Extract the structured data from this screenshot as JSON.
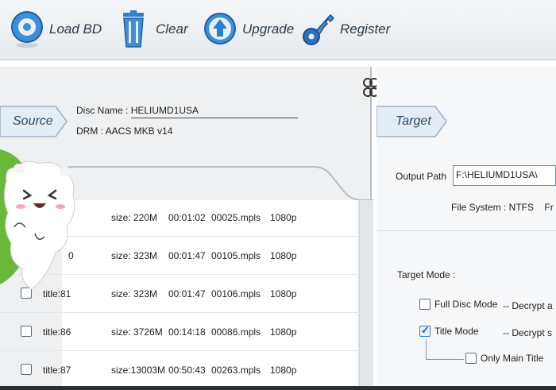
{
  "toolbar": {
    "load_label": "Load BD",
    "clear_label": "Clear",
    "upgrade_label": "Upgrade",
    "register_label": "Register"
  },
  "source": {
    "tab_label": "Source",
    "disc_name_label": "Disc Name :",
    "disc_name_value": "HELIUMD1USA",
    "drm_label": "DRM :",
    "drm_value": "AACS MKB v14"
  },
  "titles": [
    {
      "title": "",
      "size": "size:  220M",
      "duration": "00:01:02",
      "mpls": "00025.mpls",
      "res": "1080p"
    },
    {
      "title": "0",
      "size": "size:  323M",
      "duration": "00:01:47",
      "mpls": "00105.mpls",
      "res": "1080p"
    },
    {
      "title": "title:81",
      "size": "size:  323M",
      "duration": "00:01:47",
      "mpls": "00106.mpls",
      "res": "1080p"
    },
    {
      "title": "title:86",
      "size": "size: 3726M",
      "duration": "00:14:18",
      "mpls": "00086.mpls",
      "res": "1080p"
    },
    {
      "title": "title:87",
      "size": "size:13003M",
      "duration": "00:50:43",
      "mpls": "00263.mpls",
      "res": "1080p"
    }
  ],
  "target": {
    "tab_label": "Target",
    "output_path_label": "Output Path",
    "output_path_value": "F:\\HELIUMD1USA\\",
    "file_system_label": "File System :  NTFS",
    "file_system_cut": "Fr",
    "target_mode_label": "Target Mode :",
    "full_disc_label": "Full Disc Mode",
    "full_disc_desc": "-- Decrypt a",
    "title_mode_label": "Title Mode",
    "title_mode_desc": "-- Decrypt s",
    "only_main_label": "Only Main Title"
  }
}
